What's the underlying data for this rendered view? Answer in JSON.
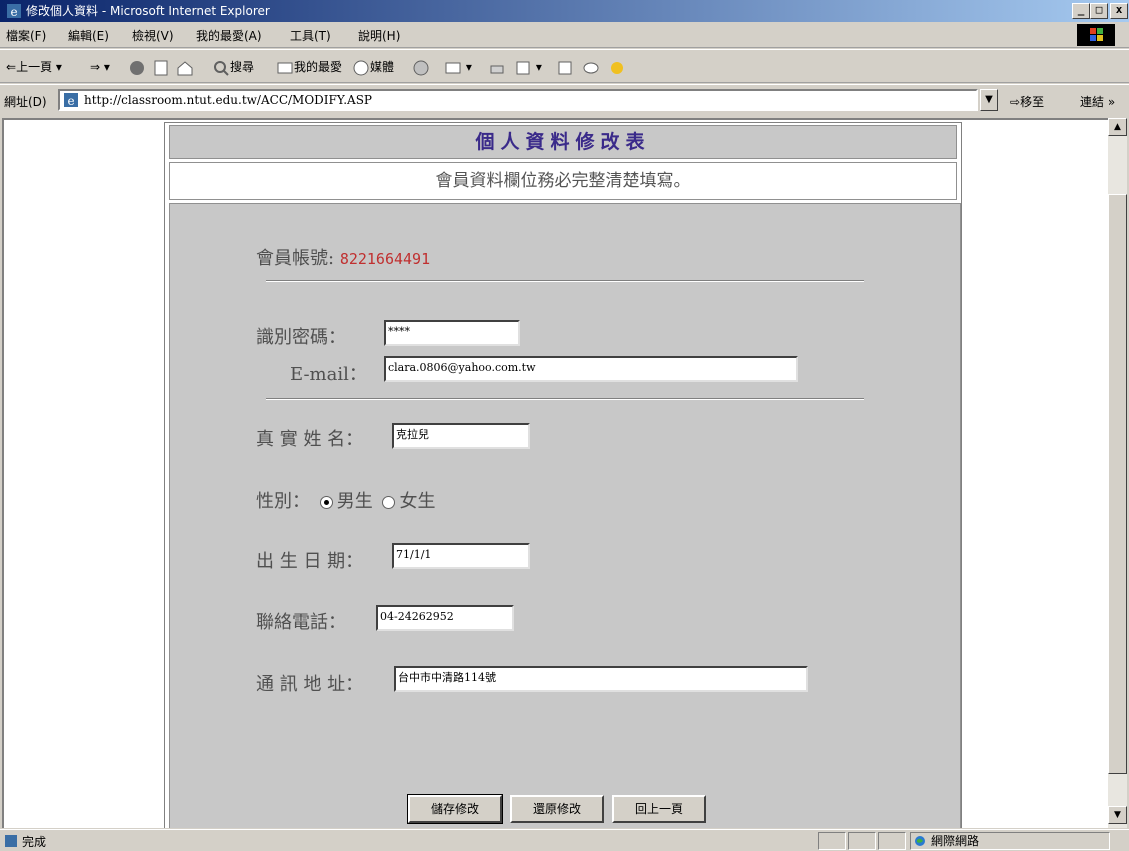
{
  "window": {
    "title": "修改個人資料 - Microsoft Internet Explorer",
    "min": "_",
    "max": "□",
    "close": "x"
  },
  "menu": [
    "檔案(F)",
    "編輯(E)",
    "檢視(V)",
    "我的最愛(A)",
    "工具(T)",
    "說明(H)"
  ],
  "toolbar": {
    "back": "上一頁",
    "search": "搜尋",
    "favorites": "我的最愛",
    "history": "媒體"
  },
  "address": {
    "label": "網址(D)",
    "url": "http://classroom.ntut.edu.tw/ACC/MODIFY.ASP",
    "go": "移至",
    "links": "連結 »"
  },
  "form": {
    "title": "個人資料修改表",
    "note": "會員資料欄位務必完整清楚填寫。",
    "account_label": "會員帳號:",
    "account_value": "8221664491",
    "password_label": "識別密碼：",
    "password_value": "****",
    "email_label": "E-mail：",
    "email_value": "clara.0806@yahoo.com.tw",
    "name_label": "真 實 姓 名：",
    "name_value": "克拉兒",
    "gender_label": "性別：",
    "gender_male": "男生",
    "gender_female": "女生",
    "birth_label": "出 生 日 期：",
    "birth_value": "71/1/1",
    "phone_label": "聯絡電話：",
    "phone_value": "04-24262952",
    "address_label": "通 訊 地 址：",
    "address_value": "台中市中清路114號",
    "save_button": "儲存修改",
    "reset_button": "還原修改",
    "back_button": "回上一頁"
  },
  "status": {
    "text": "完成",
    "zone": "網際網路"
  }
}
